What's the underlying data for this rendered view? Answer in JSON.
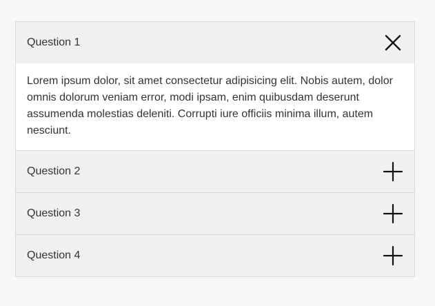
{
  "accordion": {
    "items": [
      {
        "question": "Question 1",
        "expanded": true,
        "icon": "close-icon",
        "answer": "Lorem ipsum dolor, sit amet consectetur adipisicing elit. Nobis autem, dolor omnis dolorum veniam error, modi ipsam, enim quibusdam deserunt assumenda molestias deleniti. Corrupti iure officiis minima illum, autem nesciunt."
      },
      {
        "question": "Question 2",
        "expanded": false,
        "icon": "plus-icon"
      },
      {
        "question": "Question 3",
        "expanded": false,
        "icon": "plus-icon"
      },
      {
        "question": "Question 4",
        "expanded": false,
        "icon": "plus-icon"
      }
    ]
  }
}
